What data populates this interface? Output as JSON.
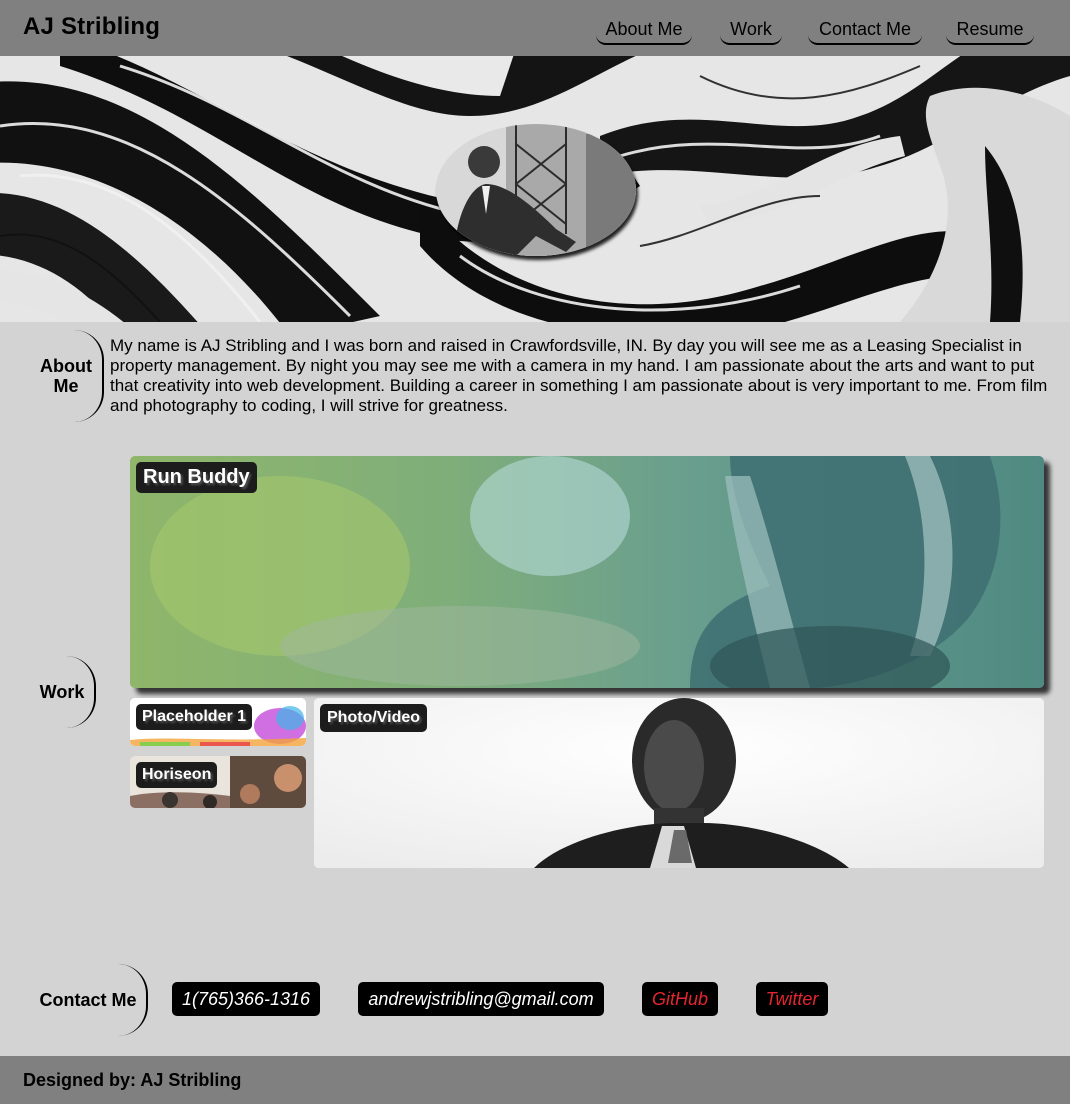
{
  "header": {
    "brand": "AJ Stribling",
    "nav": [
      "About Me",
      "Work",
      "Contact Me",
      "Resume"
    ]
  },
  "about": {
    "label": "About Me",
    "text": "My name is AJ Stribling and I was born and raised in Crawfordsville, IN. By day you will see me as a Leasing Specialist in property management. By night you may see me with a camera in my hand. I am passionate about the arts and want to put that creativity into web development. Building a career in something I am passionate about is very important to me. From film and photography to coding, I will strive for greatness."
  },
  "work": {
    "label": "Work",
    "projects": [
      "Run Buddy",
      "Placeholder 1",
      "Horiseon",
      "Photo/Video"
    ]
  },
  "contact": {
    "label": "Contact Me",
    "phone": "1(765)366-1316",
    "email": "andrewjstribling@gmail.com",
    "github": "GitHub",
    "twitter": "Twitter"
  },
  "footer": {
    "text": "Designed by: AJ Stribling"
  },
  "colors": {
    "header_bg": "#808080",
    "page_bg": "#d3d3d3",
    "pill_bg": "#000000",
    "link_red": "#e4252f"
  }
}
